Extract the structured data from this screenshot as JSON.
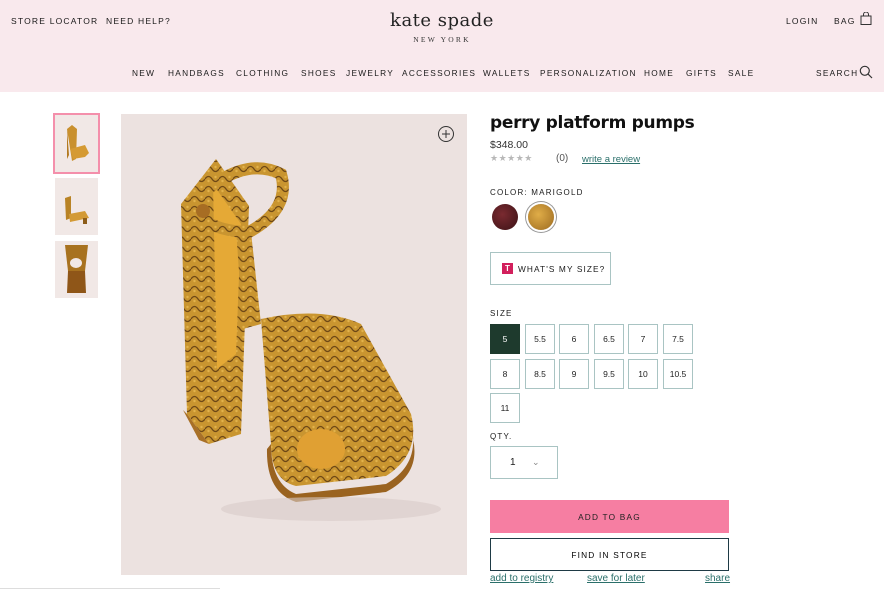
{
  "header": {
    "store_locator": "STORE LOCATOR",
    "need_help": "NEED HELP?",
    "logo_name": "kate spade",
    "logo_city": "NEW YORK",
    "login": "LOGIN",
    "bag": "BAG",
    "search": "SEARCH"
  },
  "nav": {
    "items": [
      "NEW",
      "HANDBAGS",
      "CLOTHING",
      "SHOES",
      "JEWELRY",
      "ACCESSORIES",
      "WALLETS",
      "PERSONALIZATION",
      "HOME",
      "GIFTS",
      "SALE"
    ]
  },
  "product": {
    "title": "perry platform pumps",
    "price": "$348.00",
    "stars": "★★★★★",
    "rating_value": 0,
    "review_count": "(0)",
    "write_review": "write a review",
    "color_label": "COLOR: MARIGOLD",
    "swatches": [
      {
        "name": "burgundy",
        "color": "#4a1a1e",
        "selected": false
      },
      {
        "name": "marigold",
        "color": "#c08a2a",
        "selected": true
      }
    ],
    "size_guide": "WHAT'S MY SIZE?",
    "size_label": "SIZE",
    "sizes": [
      "5",
      "5.5",
      "6",
      "6.5",
      "7",
      "7.5",
      "8",
      "8.5",
      "9",
      "9.5",
      "10",
      "10.5",
      "11"
    ],
    "selected_size": "5",
    "qty_label": "QTY.",
    "qty_value": "1",
    "add_to_bag": "ADD TO BAG",
    "find_in_store": "FIND IN STORE",
    "add_to_registry": "add to registry",
    "save_for_later": "save for later",
    "share": "share"
  },
  "colors": {
    "header_bg": "#f9e9ed",
    "accent_pink": "#f67ea2",
    "selected_size": "#1e3a2d",
    "link": "#2a6f6a"
  }
}
